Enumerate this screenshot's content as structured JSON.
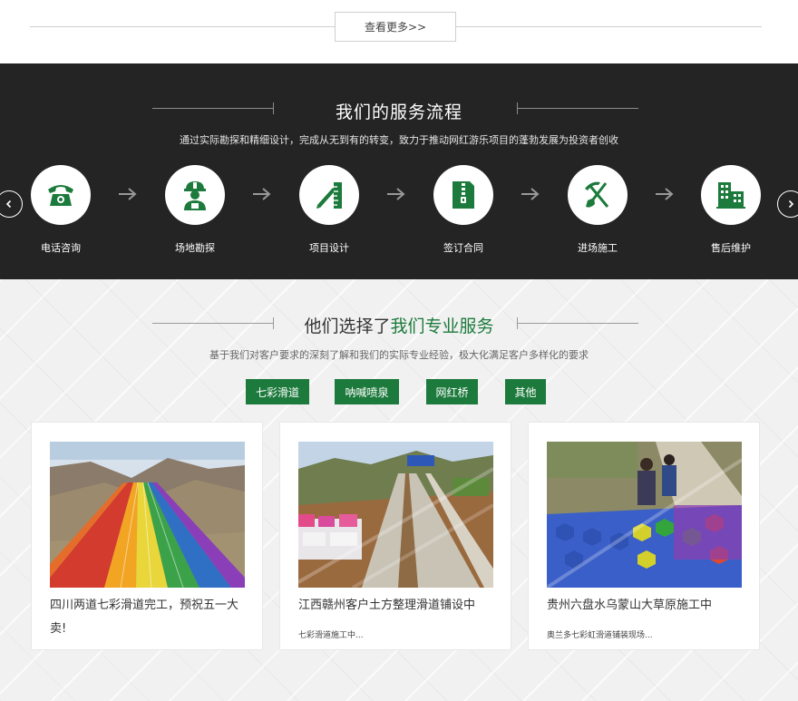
{
  "top": {
    "view_more": "查看更多>>"
  },
  "process": {
    "title": "我们的服务流程",
    "subtitle": "通过实际勘探和精细设计，完成从无到有的转变，致力于推动网红游乐项目的蓬勃发展为投资者创收",
    "steps": [
      {
        "label": "电话咨询",
        "icon": "phone-icon"
      },
      {
        "label": "场地勘探",
        "icon": "worker-icon"
      },
      {
        "label": "项目设计",
        "icon": "design-icon"
      },
      {
        "label": "签订合同",
        "icon": "contract-icon"
      },
      {
        "label": "进场施工",
        "icon": "construction-icon"
      },
      {
        "label": "售后维护",
        "icon": "building-icon"
      }
    ]
  },
  "services": {
    "title_plain": "他们选择了",
    "title_highlight": "我们专业服务",
    "subtitle": "基于我们对客户要求的深刻了解和我们的实际专业经验，极大化满足客户多样化的要求",
    "tabs": [
      "七彩滑道",
      "呐喊喷泉",
      "网红桥",
      "其他"
    ],
    "cards": [
      {
        "title": "四川两道七彩滑道完工，预祝五一大卖!",
        "desc": ""
      },
      {
        "title": "江西赣州客户土方整理滑道铺设中",
        "desc": "七彩滑道施工中..."
      },
      {
        "title": "贵州六盘水乌蒙山大草原施工中",
        "desc": "奥兰多七彩虹滑道铺装现场..."
      }
    ]
  },
  "colors": {
    "brand_green": "#1c7a3c",
    "dark_bg": "#242424"
  }
}
